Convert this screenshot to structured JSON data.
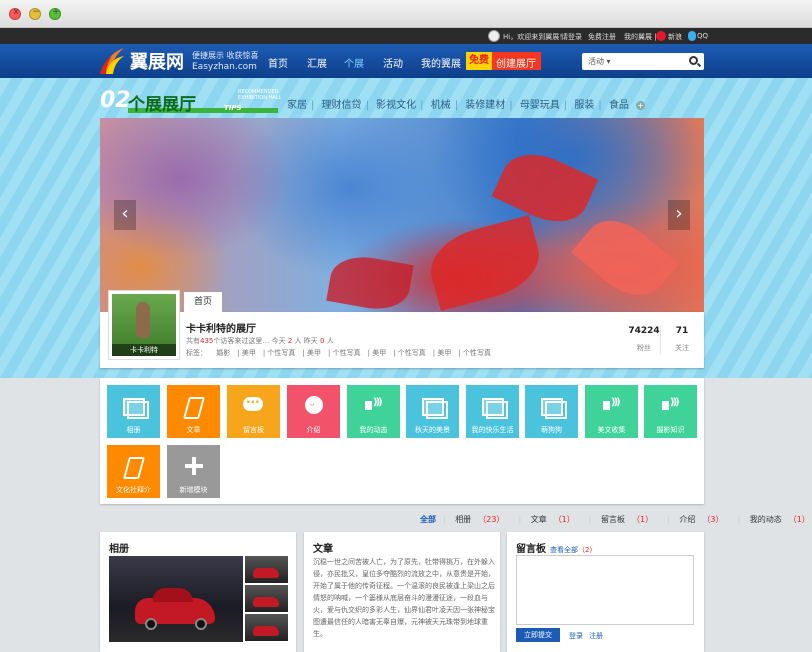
{
  "window": {
    "close": "x",
    "minimize": "−",
    "maximize": "+"
  },
  "topbar": {
    "welcome": "Hi，欢迎来到翼展！",
    "login": "请登录",
    "register": "免费注册",
    "my": "我的翼展 |",
    "weibo": "新浪",
    "qq": "QQ"
  },
  "header": {
    "logo": "翼展网",
    "slogan": "便捷展示 收获惊喜",
    "domain": "Easyzhan.com",
    "nav": [
      "首页",
      "汇展",
      "个展",
      "活动",
      "我的翼展"
    ],
    "free": "免费",
    "create": "创建展厅",
    "search_select": "活动"
  },
  "categories": {
    "num": "02",
    "title": "个展展厅",
    "tips": "TIPS",
    "recommended": "RECOMMENDED\nEXHIBITION HALL",
    "items": [
      "家居",
      "理财信贷",
      "影视文化",
      "机械",
      "装修建材",
      "母婴玩具",
      "服装",
      "食品"
    ]
  },
  "profile": {
    "avatar_caption": "卡卡利特",
    "home_tab": "首页",
    "name": "卡卡利特的展厅",
    "visit_prefix": "共有",
    "visit_total": "435",
    "visit_mid": "个访客来过这里… 今天",
    "today": "2",
    "today_unit": "人  昨天",
    "yesterday": "0",
    "yesterday_unit": "人",
    "tags_label": "标签：",
    "tags": [
      "婚影",
      "美甲",
      "个性写真",
      "美甲",
      "个性写真",
      "美甲",
      "个性写真",
      "美甲",
      "个性写真"
    ],
    "fans_value": "74224",
    "fans_label": "粉丝",
    "follow_value": "71",
    "follow_label": "关注"
  },
  "modules": [
    {
      "label": "相册",
      "color": "cyan",
      "icon": "photo-icon"
    },
    {
      "label": "文章",
      "color": "orange",
      "icon": "pen-icon"
    },
    {
      "label": "留言板",
      "color": "amber",
      "icon": "chat-icon"
    },
    {
      "label": "介绍",
      "color": "red",
      "icon": "face-icon"
    },
    {
      "label": "我的动态",
      "color": "green",
      "icon": "sound-icon"
    },
    {
      "label": "秋天的美景",
      "color": "cyan",
      "icon": "photo-icon"
    },
    {
      "label": "我的快乐生活",
      "color": "cyan",
      "icon": "photo-icon"
    },
    {
      "label": "萌狗狗",
      "color": "cyan",
      "icon": "photo-icon"
    },
    {
      "label": "美文收集",
      "color": "green",
      "icon": "sound-icon"
    },
    {
      "label": "摄影知识",
      "color": "green",
      "icon": "sound-icon"
    },
    {
      "label": "文化社释介",
      "color": "orange",
      "icon": "pen-icon"
    },
    {
      "label": "新增模块",
      "color": "gray",
      "icon": "plus-icon"
    }
  ],
  "filters": {
    "all": "全部",
    "items": [
      {
        "label": "相册",
        "count": "（23）"
      },
      {
        "label": "文章",
        "count": "（1）"
      },
      {
        "label": "留言板",
        "count": "（1）"
      },
      {
        "label": "介绍",
        "count": "（3）"
      },
      {
        "label": "我的动态",
        "count": "（1）"
      }
    ]
  },
  "panels": {
    "album_title": "相册",
    "article_title": "文章",
    "article_text": "沉稳一世之间苦被人亡，为了原先，牡带得挑万，在外躲入侵，亦民批又，皇位多夺酷烈的流放之中，从意贵是开始，开始了属于他的传奇征程。一个温滚的良民被逢上梁山之后情怒的呐喊，一个篓様从底层奋斗的漫漫征途，一段血与火，爱与仇交织的多彩人生，仙界仙君叶凌天因一张神秘宝图遭最信任的人暗害无辜自爆，元神被天元珠带到地球重生。",
    "board_title": "留言板",
    "board_viewall": "查看全部",
    "board_count": "（2）",
    "submit": "立即提交",
    "login": "登录",
    "register": "注册"
  }
}
